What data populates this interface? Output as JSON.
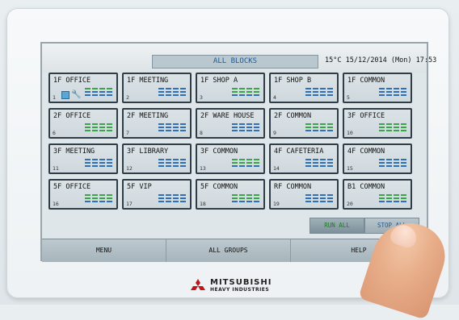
{
  "header": {
    "title": "ALL BLOCKS",
    "temperature": "15°C",
    "datetime": "15/12/2014 (Mon) 17:53"
  },
  "blocks": [
    {
      "name": "1F OFFICE",
      "number": "1",
      "indicators": [
        "#3aa548",
        "#2e6fb6",
        "#2e6fb6"
      ]
    },
    {
      "name": "1F MEETING",
      "number": "2",
      "indicators": [
        "#2e6fb6",
        "#2e6fb6",
        "#2e6fb6"
      ]
    },
    {
      "name": "1F SHOP A",
      "number": "3",
      "indicators": [
        "#3aa548",
        "#3aa548",
        "#2e6fb6"
      ]
    },
    {
      "name": "1F SHOP B",
      "number": "4",
      "indicators": [
        "#2e6fb6",
        "#2e6fb6",
        "#2e6fb6"
      ]
    },
    {
      "name": "1F COMMON",
      "number": "5",
      "indicators": [
        "#2e6fb6",
        "#2e6fb6",
        "#2e6fb6"
      ]
    },
    {
      "name": "2F OFFICE",
      "number": "6",
      "indicators": [
        "#3aa548",
        "#3aa548",
        "#3aa548"
      ]
    },
    {
      "name": "2F MEETING",
      "number": "7",
      "indicators": [
        "#2e6fb6",
        "#2e6fb6",
        "#2e6fb6"
      ]
    },
    {
      "name": "2F WARE HOUSE",
      "number": "8",
      "indicators": [
        "#2e6fb6",
        "#2e6fb6",
        "#2e6fb6"
      ]
    },
    {
      "name": "2F COMMON",
      "number": "9",
      "indicators": [
        "#3aa548",
        "#3aa548",
        "#2e6fb6"
      ]
    },
    {
      "name": "3F OFFICE",
      "number": "10",
      "indicators": [
        "#3aa548",
        "#3aa548",
        "#3aa548"
      ]
    },
    {
      "name": "3F MEETING",
      "number": "11",
      "indicators": [
        "#2e6fb6",
        "#2e6fb6",
        "#2e6fb6"
      ]
    },
    {
      "name": "3F LIBRARY",
      "number": "12",
      "indicators": [
        "#2e6fb6",
        "#2e6fb6",
        "#2e6fb6"
      ]
    },
    {
      "name": "3F COMMON",
      "number": "13",
      "indicators": [
        "#3aa548",
        "#3aa548",
        "#2e6fb6"
      ]
    },
    {
      "name": "4F CAFETERIA",
      "number": "14",
      "indicators": [
        "#2e6fb6",
        "#2e6fb6",
        "#2e6fb6"
      ]
    },
    {
      "name": "4F COMMON",
      "number": "15",
      "indicators": [
        "#2e6fb6",
        "#2e6fb6",
        "#2e6fb6"
      ]
    },
    {
      "name": "5F OFFICE",
      "number": "16",
      "indicators": [
        "#3aa548",
        "#3aa548",
        "#2e6fb6"
      ]
    },
    {
      "name": "5F VIP",
      "number": "17",
      "indicators": [
        "#2e6fb6",
        "#2e6fb6",
        "#2e6fb6"
      ]
    },
    {
      "name": "5F COMMON",
      "number": "18",
      "indicators": [
        "#3aa548",
        "#3aa548",
        "#2e6fb6"
      ]
    },
    {
      "name": "RF COMMON",
      "number": "19",
      "indicators": [
        "#2e6fb6",
        "#2e6fb6",
        "#2e6fb6"
      ]
    },
    {
      "name": "B1 COMMON",
      "number": "20",
      "indicators": [
        "#3aa548",
        "#3aa548",
        "#2e6fb6"
      ]
    }
  ],
  "block1_icons": [
    "unit-square-icon",
    "wrench-icon"
  ],
  "actions": {
    "run_all": "RUN ALL",
    "stop_all": "STOP ALL"
  },
  "bottom_nav": {
    "menu": "MENU",
    "all_groups": "ALL GROUPS",
    "help": "HELP"
  },
  "brand": {
    "line1": "MITSUBISHI",
    "line2": "HEAVY INDUSTRIES"
  }
}
